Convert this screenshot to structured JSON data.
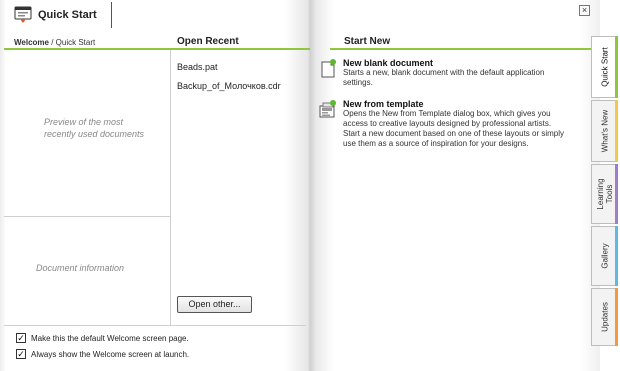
{
  "window": {
    "title": "Quick Start",
    "close_glyph": "×"
  },
  "breadcrumb": {
    "welcome": "Welcome",
    "separator": " / ",
    "current": "Quick Start"
  },
  "left_panel": {
    "preview_text": "Preview of the most recently used documents",
    "doc_info_text": "Document information"
  },
  "open_recent": {
    "header": "Open Recent",
    "items": [
      "Beads.pat",
      "Backup_of_Молочков.cdr"
    ],
    "open_other_label": "Open other..."
  },
  "start_new": {
    "header": "Start New",
    "tasks": [
      {
        "title": "New blank document",
        "description": "Starts a new, blank document with the default application settings.",
        "icon": "blank-document-icon"
      },
      {
        "title": "New from template",
        "description": "Opens the New from Template dialog box, which gives you access to creative layouts designed by professional artists. Start a new document based on one of these layouts or simply use them as a source of inspiration for your designs.",
        "icon": "template-icon"
      }
    ]
  },
  "options": {
    "default_page_label": "Make this the default Welcome screen page.",
    "default_page_checked": true,
    "always_show_label": "Always show the Welcome screen at launch.",
    "always_show_checked": true,
    "check_glyph": "✓"
  },
  "side_tabs": [
    {
      "label": "Quick Start",
      "color": "#8ec63f",
      "active": true
    },
    {
      "label": "What's New",
      "color": "#f2c94c",
      "active": false
    },
    {
      "label": "Learning Tools",
      "color": "#9b7fc9",
      "active": false
    },
    {
      "label": "Gallery",
      "color": "#5fb8e6",
      "active": false
    },
    {
      "label": "Updates",
      "color": "#f39a3c",
      "active": false
    }
  ],
  "colors": {
    "accent_green": "#8ec63f"
  }
}
